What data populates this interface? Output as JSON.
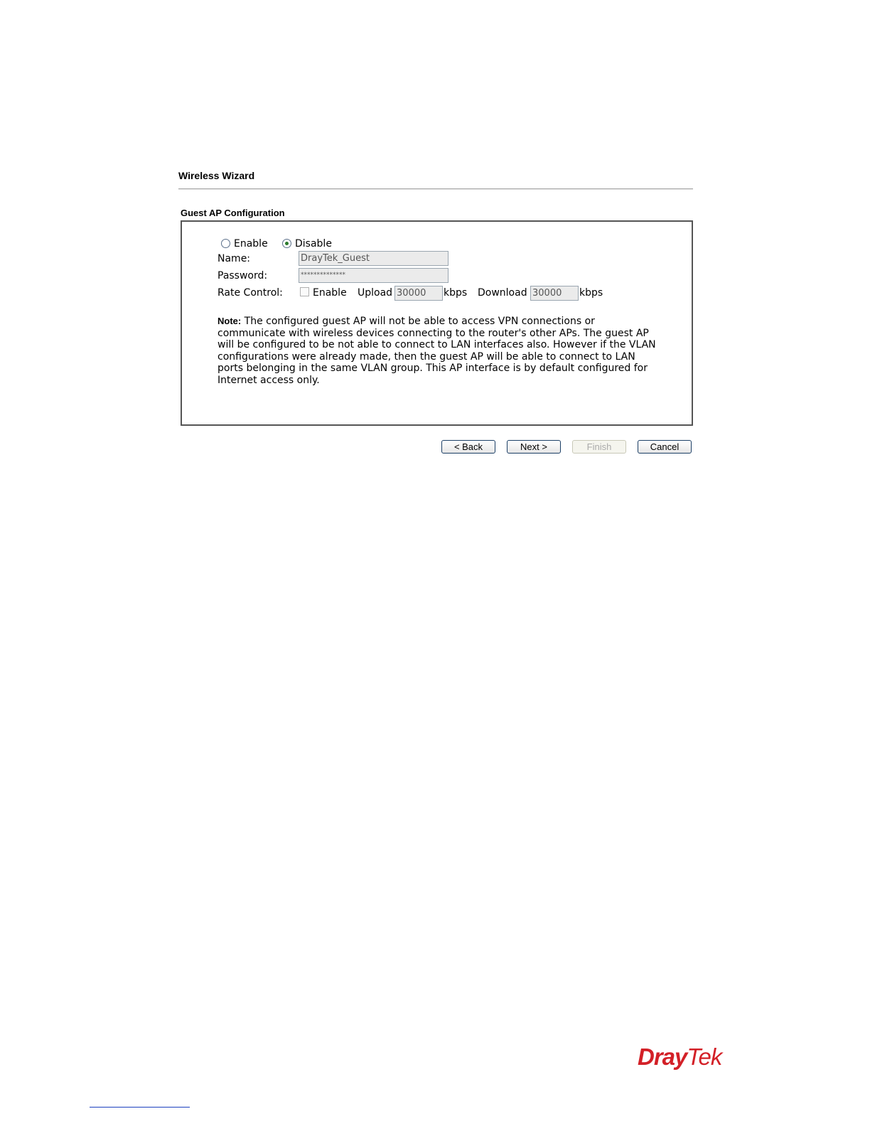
{
  "wizard": {
    "title": "Wireless Wizard"
  },
  "guest_ap": {
    "section_title": "Guest AP Configuration",
    "enable_label": "Enable",
    "disable_label": "Disable",
    "selected": "Disable",
    "name_label": "Name:",
    "name_value": "DrayTek_Guest",
    "password_label": "Password:",
    "password_value": "**************",
    "rate_control_label": "Rate Control:",
    "rate_enable_label": "Enable",
    "rate_enabled": false,
    "upload_label": "Upload",
    "upload_value": "30000",
    "download_label": "Download",
    "download_value": "30000",
    "unit": "kbps",
    "note_label": "Note:",
    "note_text": "The configured guest AP will not be able to access VPN connections or communicate with wireless devices connecting to the router's other APs. The guest AP will be configured to be not able to connect to LAN interfaces also. However if the VLAN configurations were already made, then the guest AP will be able to connect to LAN ports belonging in the same VLAN group. This AP interface is by default configured for Internet access only."
  },
  "buttons": {
    "back": "< Back",
    "next": "Next >",
    "finish": "Finish",
    "cancel": "Cancel"
  },
  "branding": {
    "logo_dray": "Dray",
    "logo_tek": "Tek",
    "brand_color": "#d32027"
  }
}
